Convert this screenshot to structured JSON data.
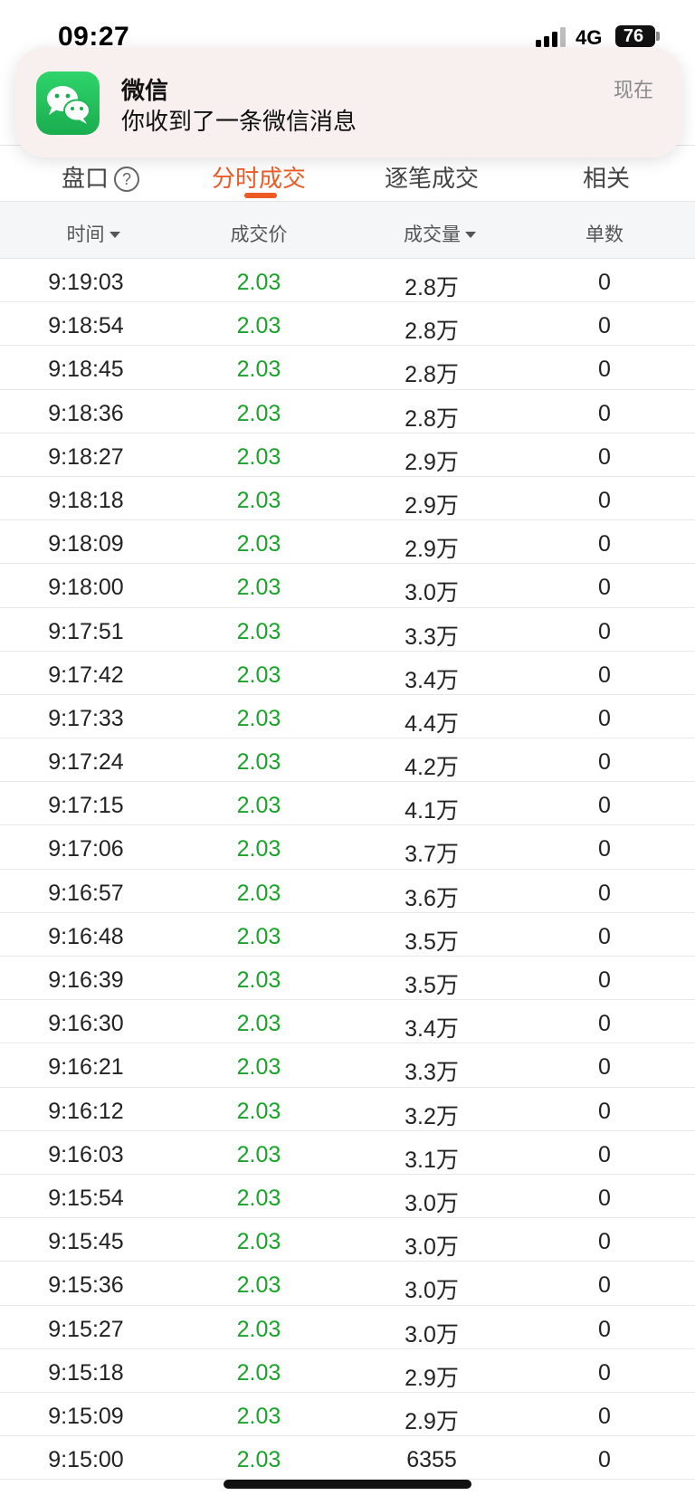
{
  "status_bar": {
    "time": "09:27",
    "network": "4G",
    "battery": "76"
  },
  "notification": {
    "app": "微信",
    "message": "你收到了一条微信消息",
    "time": "现在",
    "icon": "wechat-icon"
  },
  "tabs": [
    {
      "label": "盘口",
      "icon": "help-icon",
      "icon_glyph": "?"
    },
    {
      "label": "分时成交",
      "active": true
    },
    {
      "label": "逐笔成交"
    },
    {
      "label": "相关"
    }
  ],
  "columns": {
    "time": "时间",
    "price": "成交价",
    "volume": "成交量",
    "count": "单数"
  },
  "colors": {
    "accent": "#ee5a24",
    "price_green": "#1aa32a"
  },
  "trades": [
    {
      "time": "9:19:03",
      "price": "2.03",
      "volume": "2.8万",
      "count": "0"
    },
    {
      "time": "9:18:54",
      "price": "2.03",
      "volume": "2.8万",
      "count": "0"
    },
    {
      "time": "9:18:45",
      "price": "2.03",
      "volume": "2.8万",
      "count": "0"
    },
    {
      "time": "9:18:36",
      "price": "2.03",
      "volume": "2.8万",
      "count": "0"
    },
    {
      "time": "9:18:27",
      "price": "2.03",
      "volume": "2.9万",
      "count": "0"
    },
    {
      "time": "9:18:18",
      "price": "2.03",
      "volume": "2.9万",
      "count": "0"
    },
    {
      "time": "9:18:09",
      "price": "2.03",
      "volume": "2.9万",
      "count": "0"
    },
    {
      "time": "9:18:00",
      "price": "2.03",
      "volume": "3.0万",
      "count": "0"
    },
    {
      "time": "9:17:51",
      "price": "2.03",
      "volume": "3.3万",
      "count": "0"
    },
    {
      "time": "9:17:42",
      "price": "2.03",
      "volume": "3.4万",
      "count": "0"
    },
    {
      "time": "9:17:33",
      "price": "2.03",
      "volume": "4.4万",
      "count": "0"
    },
    {
      "time": "9:17:24",
      "price": "2.03",
      "volume": "4.2万",
      "count": "0"
    },
    {
      "time": "9:17:15",
      "price": "2.03",
      "volume": "4.1万",
      "count": "0"
    },
    {
      "time": "9:17:06",
      "price": "2.03",
      "volume": "3.7万",
      "count": "0"
    },
    {
      "time": "9:16:57",
      "price": "2.03",
      "volume": "3.6万",
      "count": "0"
    },
    {
      "time": "9:16:48",
      "price": "2.03",
      "volume": "3.5万",
      "count": "0"
    },
    {
      "time": "9:16:39",
      "price": "2.03",
      "volume": "3.5万",
      "count": "0"
    },
    {
      "time": "9:16:30",
      "price": "2.03",
      "volume": "3.4万",
      "count": "0"
    },
    {
      "time": "9:16:21",
      "price": "2.03",
      "volume": "3.3万",
      "count": "0"
    },
    {
      "time": "9:16:12",
      "price": "2.03",
      "volume": "3.2万",
      "count": "0"
    },
    {
      "time": "9:16:03",
      "price": "2.03",
      "volume": "3.1万",
      "count": "0"
    },
    {
      "time": "9:15:54",
      "price": "2.03",
      "volume": "3.0万",
      "count": "0"
    },
    {
      "time": "9:15:45",
      "price": "2.03",
      "volume": "3.0万",
      "count": "0"
    },
    {
      "time": "9:15:36",
      "price": "2.03",
      "volume": "3.0万",
      "count": "0"
    },
    {
      "time": "9:15:27",
      "price": "2.03",
      "volume": "3.0万",
      "count": "0"
    },
    {
      "time": "9:15:18",
      "price": "2.03",
      "volume": "2.9万",
      "count": "0"
    },
    {
      "time": "9:15:09",
      "price": "2.03",
      "volume": "2.9万",
      "count": "0"
    },
    {
      "time": "9:15:00",
      "price": "2.03",
      "volume": "6355",
      "count": "0"
    }
  ]
}
